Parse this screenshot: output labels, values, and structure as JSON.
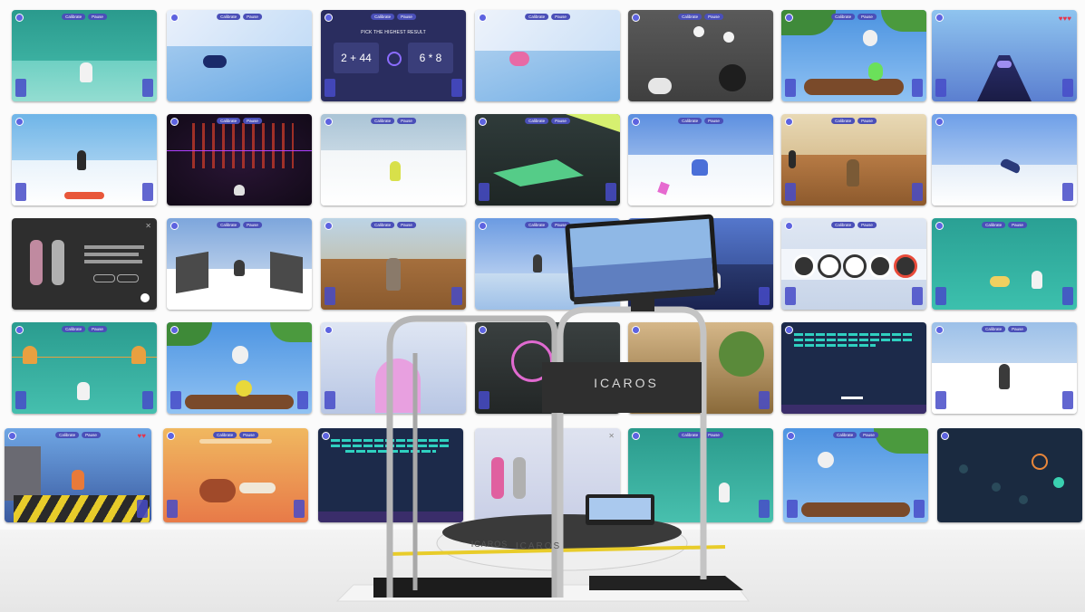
{
  "tile_hud": {
    "calibrate": "Calibrate",
    "pause": "Pause"
  },
  "math_game": {
    "prompt": "PICK THE HIGHEST RESULT",
    "left": "2 + 44",
    "right": "6 * 8"
  },
  "machine": {
    "brand": "ICAROS"
  },
  "colors": {
    "hud_button": "#4a4fb8",
    "accent": "#5d63e0",
    "strap": "#e8cc2a"
  }
}
